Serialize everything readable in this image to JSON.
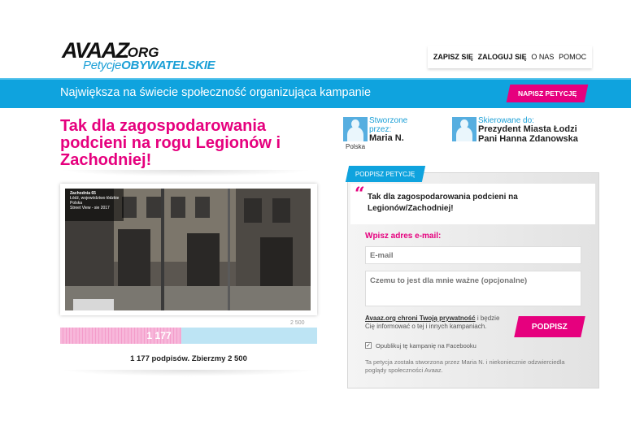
{
  "header": {
    "logo_main": "AVAAZ",
    "logo_org": ".ORG",
    "logo_sub_a": "Petycje",
    "logo_sub_b": "OBYWATELSKIE",
    "nav": [
      "ZAPISZ SIĘ",
      "ZALOGUJ SIĘ",
      "O NAS",
      "POMOC"
    ]
  },
  "band": {
    "tagline": "Największa na świecie społeczność organizująca kampanie",
    "write_button": "NAPISZ PETYCJĘ"
  },
  "petition": {
    "title": "Tak dla zagospodarowania podcieni na rogu Legionów i Zachodniej!",
    "created_label": "Stworzone przez:",
    "creator": "Maria N.",
    "creator_country": "Polska",
    "target_label": "Skierowane do:",
    "target": "Prezydent Miasta Łodzi Pani Hanna Zdanowska"
  },
  "progress": {
    "current": 1177,
    "current_label": "1 177",
    "goal": 2500,
    "goal_label": "2 500",
    "fraction": 0.47,
    "summary": "1 177 podpisów. Zbierzmy 2 500"
  },
  "photo": {
    "streetview_title": "Zachodnia 65",
    "streetview_sub": "Łódź, województwo łódzkie",
    "streetview_sub2": "Polska",
    "streetview_date": "Street View - sie 2017"
  },
  "sign": {
    "tab": "PODPISZ PETYCJĘ",
    "quote": "Tak dla zagospodarowania podcieni na Legionów/Zachodniej!",
    "email_label": "Wpisz adres e-mail:",
    "email_placeholder": "E-mail",
    "comment_placeholder": "Czemu to jest dla mnie ważne (opcjonalne)",
    "privacy_link": "Avaaz.org chroni Twoją prywatność",
    "privacy_rest": " i będzie Cię informować o tej i innych kampaniach.",
    "button": "PODPISZ",
    "facebook_label": "Opublikuj tę kampanię na Facebooku",
    "facebook_checked": true,
    "disclaimer": "Ta petycja została stworzona przez Maria N. i niekoniecznie odzwierciedla poglądy społeczności Avaaz."
  },
  "colors": {
    "accent": "#e6007e",
    "brand": "#0fa3de",
    "progress": "#f7b7da"
  }
}
